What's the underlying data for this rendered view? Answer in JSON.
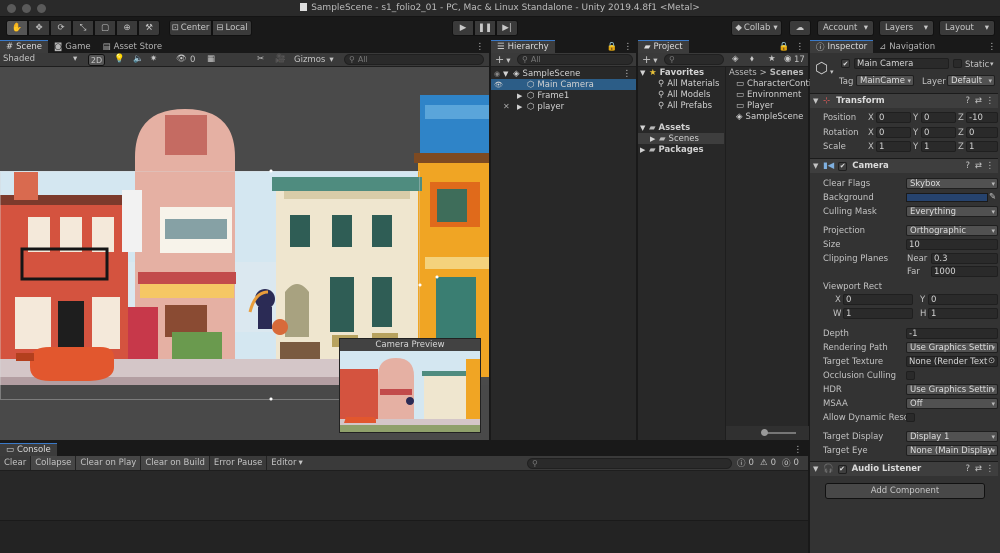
{
  "window": {
    "title": "SampleScene - s1_folio2_01 - PC, Mac & Linux Standalone - Unity 2019.4.8f1 <Metal>"
  },
  "toolbar": {
    "pivot_label": "Center",
    "space_label": "Local",
    "collab_label": "Collab",
    "account_label": "Account",
    "layers_label": "Layers",
    "layout_label": "Layout"
  },
  "scene_panel": {
    "tabs": [
      "Scene",
      "Game",
      "Asset Store"
    ],
    "shading_mode": "Shaded",
    "mode_2d": "2D",
    "hidden_count": "0",
    "gizmos_label": "Gizmos",
    "search_placeholder": "All",
    "camera_preview_title": "Camera Preview"
  },
  "hierarchy": {
    "tab_label": "Hierarchy",
    "search_placeholder": "All",
    "items": [
      {
        "label": "SampleScene"
      },
      {
        "label": "Main Camera"
      },
      {
        "label": "Frame1"
      },
      {
        "label": "player"
      }
    ]
  },
  "project": {
    "tab_label": "Project",
    "search_placeholder": "",
    "hidden_count": "17",
    "tree": {
      "favorites_label": "Favorites",
      "favorites": [
        "All Materials",
        "All Models",
        "All Prefabs"
      ],
      "assets_label": "Assets",
      "scenes_label": "Scenes",
      "packages_label": "Packages"
    },
    "breadcrumb": {
      "root": "Assets",
      "sep": ">",
      "current": "Scenes"
    },
    "files": [
      "CharacterConti",
      "Environment",
      "Player",
      "SampleScene"
    ]
  },
  "inspector": {
    "tabs": [
      "Inspector",
      "Navigation"
    ],
    "object_name": "Main Camera",
    "static_label": "Static",
    "tag_label": "Tag",
    "tag_value": "MainCame",
    "layer_label": "Layer",
    "layer_value": "Default",
    "transform": {
      "title": "Transform",
      "position_label": "Position",
      "rotation_label": "Rotation",
      "scale_label": "Scale",
      "position": {
        "x": "0",
        "y": "0",
        "z": "-10"
      },
      "rotation": {
        "x": "0",
        "y": "0",
        "z": "0"
      },
      "scale": {
        "x": "1",
        "y": "1",
        "z": "1"
      }
    },
    "camera": {
      "title": "Camera",
      "clear_flags_label": "Clear Flags",
      "clear_flags": "Skybox",
      "background_label": "Background",
      "background_color": "#26436e",
      "culling_mask_label": "Culling Mask",
      "culling_mask": "Everything",
      "projection_label": "Projection",
      "projection": "Orthographic",
      "size_label": "Size",
      "size": "10",
      "clipping_label": "Clipping Planes",
      "near_label": "Near",
      "near": "0.3",
      "far_label": "Far",
      "far": "1000",
      "viewport_label": "Viewport Rect",
      "viewport": {
        "x": "0",
        "y": "0",
        "w": "1",
        "h": "1"
      },
      "depth_label": "Depth",
      "depth": "-1",
      "rendering_path_label": "Rendering Path",
      "rendering_path": "Use Graphics Settin",
      "target_texture_label": "Target Texture",
      "target_texture": "None (Render Text",
      "occlusion_label": "Occlusion Culling",
      "hdr_label": "HDR",
      "hdr": "Use Graphics Settin",
      "msaa_label": "MSAA",
      "msaa": "Off",
      "dynamic_res_label": "Allow Dynamic Resol",
      "target_display_label": "Target Display",
      "target_display": "Display 1",
      "target_eye_label": "Target Eye",
      "target_eye": "None (Main Display"
    },
    "audio_listener_title": "Audio Listener",
    "add_component_label": "Add Component"
  },
  "console": {
    "tab_label": "Console",
    "buttons": [
      "Clear",
      "Collapse",
      "Clear on Play",
      "Clear on Build",
      "Error Pause",
      "Editor"
    ],
    "counts": {
      "info": "0",
      "warn": "0",
      "error": "0"
    }
  },
  "colors": {
    "selection": "#2c5d87",
    "accent": "#3a79c8",
    "sky": "#cfe3ef"
  }
}
